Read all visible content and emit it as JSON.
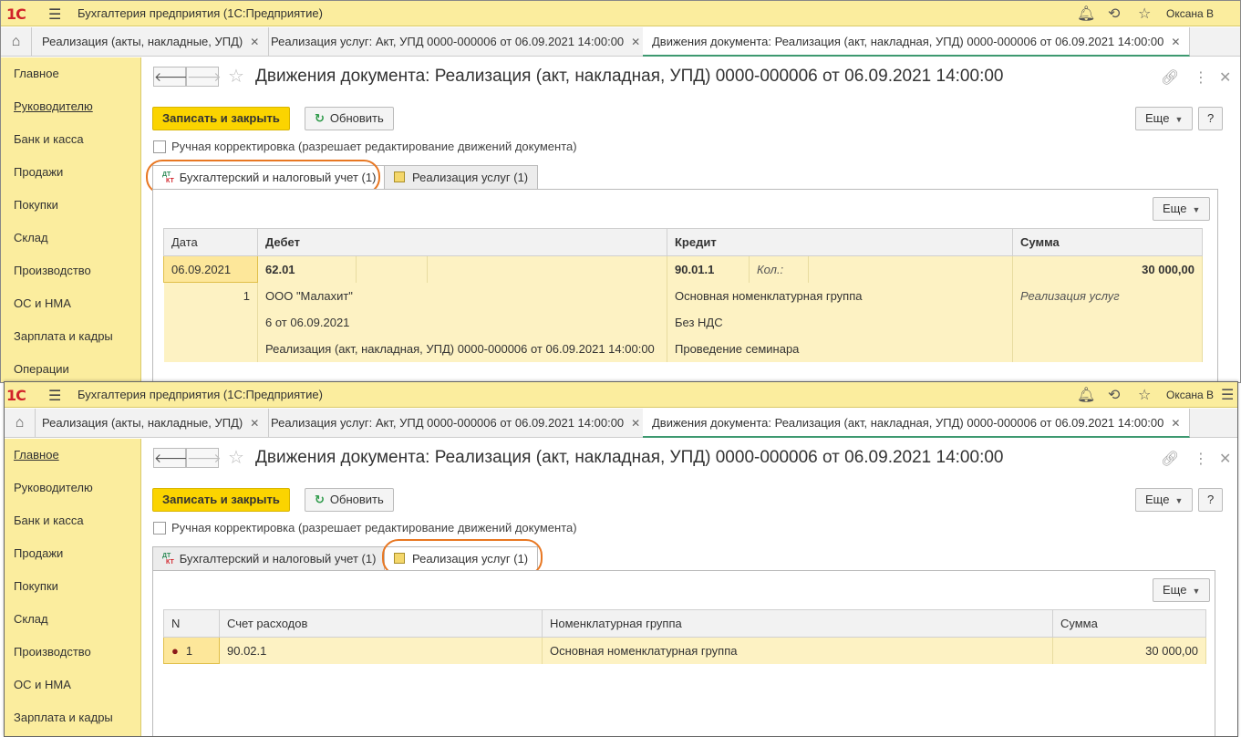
{
  "app": {
    "title": "Бухгалтерия предприятия  (1С:Предприятие)",
    "logo": "1С",
    "user": "Оксана В"
  },
  "open_tabs": [
    {
      "label": "Реализация (акты, накладные, УПД)"
    },
    {
      "label": "Реализация услуг: Акт, УПД 0000-000006 от 06.09.2021 14:00:00"
    },
    {
      "label": "Движения документа: Реализация (акт, накладная, УПД) 0000-000006 от 06.09.2021 14:00:00"
    }
  ],
  "sidebar": {
    "items": [
      {
        "label": "Главное"
      },
      {
        "label": "Руководителю"
      },
      {
        "label": "Банк и касса"
      },
      {
        "label": "Продажи"
      },
      {
        "label": "Покупки"
      },
      {
        "label": "Склад"
      },
      {
        "label": "Производство"
      },
      {
        "label": "ОС и НМА"
      },
      {
        "label": "Зарплата и кадры"
      },
      {
        "label": "Операции"
      }
    ]
  },
  "document": {
    "title": "Движения документа: Реализация (акт, накладная, УПД) 0000-000006 от 06.09.2021 14:00:00",
    "save_close": "Записать и закрыть",
    "refresh": "Обновить",
    "more": "Еще",
    "help": "?",
    "manual_edit": "Ручная корректировка (разрешает редактирование движений документа)"
  },
  "register_tabs": [
    {
      "label": "Бухгалтерский и налоговый учет (1)",
      "icon": "dt-kt-icon"
    },
    {
      "label": "Реализация услуг (1)",
      "icon": "register-icon"
    }
  ],
  "accounting": {
    "columns": [
      "Дата",
      "Дебет",
      "Кредит",
      "Сумма"
    ],
    "row": {
      "date": "06.09.2021",
      "line_no": "1",
      "debit_account": "62.01",
      "debit_sub1": "ООО \"Малахит\"",
      "debit_sub2": "6 от 06.09.2021",
      "debit_sub3": "Реализация (акт, накладная, УПД) 0000-000006 от 06.09.2021 14:00:00",
      "credit_account": "90.01.1",
      "credit_qty_label": "Кол.:",
      "credit_sub1": "Основная номенклатурная группа",
      "credit_sub2": "Без НДС",
      "credit_sub3": "Проведение семинара",
      "amount": "30 000,00",
      "content": "Реализация услуг"
    }
  },
  "services": {
    "columns": [
      "N",
      "Счет расходов",
      "Номенклатурная группа",
      "Сумма"
    ],
    "rows": [
      {
        "n": "1",
        "account": "90.02.1",
        "group": "Основная номенклатурная группа",
        "amount": "30 000,00"
      }
    ]
  },
  "colors": {
    "accent_yellow": "#fbed9e",
    "primary_button": "#fbd400",
    "highlight_ring": "#e87722",
    "active_tab_underline": "#3d9970"
  }
}
